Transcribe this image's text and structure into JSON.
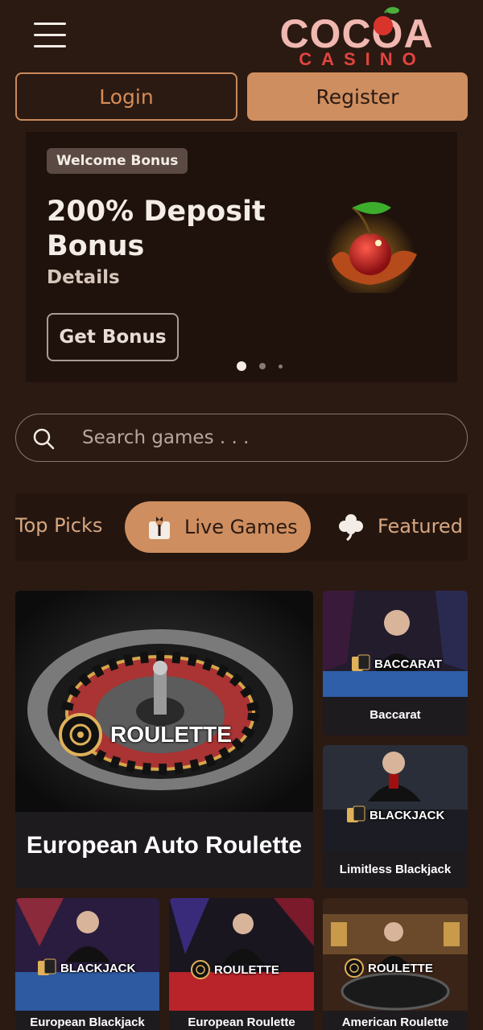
{
  "header": {
    "logo_top": "COCOA",
    "logo_bottom": "CASINO",
    "login_label": "Login",
    "register_label": "Register"
  },
  "banner": {
    "badge": "Welcome Bonus",
    "title": "200% Deposit Bonus",
    "details": "Details",
    "cta": "Get Bonus",
    "slides": 3,
    "active_slide": 1
  },
  "search": {
    "placeholder": "Search games . . ."
  },
  "tabs": [
    {
      "label": "Top Picks",
      "icon": "none"
    },
    {
      "label": "Live Games",
      "icon": "dealer-icon",
      "active": true
    },
    {
      "label": "Featured G",
      "icon": "clover-icon"
    }
  ],
  "games": {
    "featured": {
      "title": "European Auto Roulette",
      "tag": "ROULETTE"
    },
    "baccarat": {
      "title": "Baccarat",
      "tag": "BACCARAT"
    },
    "limitless_blackjack": {
      "title": "Limitless Blackjack",
      "tag": "BLACKJACK"
    },
    "european_blackjack": {
      "title": "European Blackjack",
      "tag": "BLACKJACK"
    },
    "european_roulette": {
      "title": "European Roulette",
      "tag": "ROULETTE"
    },
    "american_roulette": {
      "title": "American Roulette",
      "tag": "ROULETTE"
    }
  },
  "colors": {
    "background": "#2b1a12",
    "accent": "#cf8e5f",
    "banner_bg": "#1f120c",
    "logo_pink": "#f0b8b0",
    "logo_red": "#e3443f"
  }
}
